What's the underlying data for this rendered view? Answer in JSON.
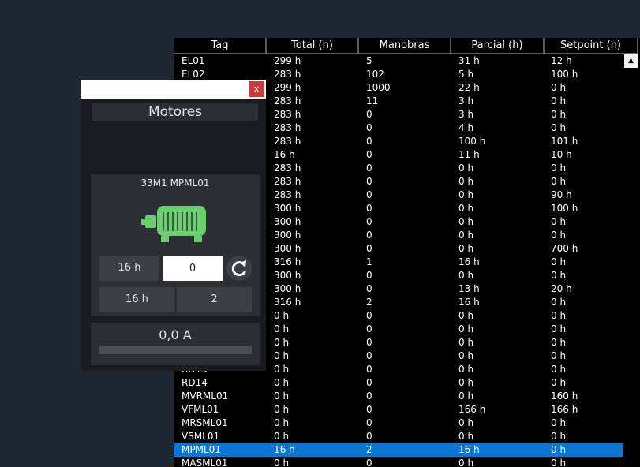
{
  "table": {
    "columns": [
      "Tag",
      "Total (h)",
      "Manobras",
      "Parcial (h)",
      "Setpoint (h)"
    ],
    "rows": [
      [
        "EL01",
        "299 h",
        "5",
        "31 h",
        "12 h"
      ],
      [
        "EL02",
        "283 h",
        "102",
        "5 h",
        "100 h"
      ],
      [
        "",
        "299 h",
        "1000",
        "22 h",
        "0 h"
      ],
      [
        "",
        "283 h",
        "11",
        "3 h",
        "0 h"
      ],
      [
        "",
        "283 h",
        "0",
        "3 h",
        "0 h"
      ],
      [
        "",
        "283 h",
        "0",
        "4 h",
        "0 h"
      ],
      [
        "",
        "283 h",
        "0",
        "100 h",
        "101 h"
      ],
      [
        "",
        "16 h",
        "0",
        "11 h",
        "10 h"
      ],
      [
        "",
        "283 h",
        "0",
        "0 h",
        "0 h"
      ],
      [
        "",
        "283 h",
        "0",
        "0 h",
        "0 h"
      ],
      [
        "",
        "283 h",
        "0",
        "0 h",
        "90 h"
      ],
      [
        "",
        "300 h",
        "0",
        "0 h",
        "100 h"
      ],
      [
        "",
        "300 h",
        "0",
        "0 h",
        "0 h"
      ],
      [
        "",
        "300 h",
        "0",
        "0 h",
        "0 h"
      ],
      [
        "",
        "300 h",
        "0",
        "0 h",
        "700 h"
      ],
      [
        "",
        "316 h",
        "1",
        "16 h",
        "0 h"
      ],
      [
        "",
        "300 h",
        "0",
        "0 h",
        "0 h"
      ],
      [
        "",
        "300 h",
        "0",
        "13 h",
        "20 h"
      ],
      [
        "",
        "316 h",
        "2",
        "16 h",
        "0 h"
      ],
      [
        "",
        "0 h",
        "0",
        "0 h",
        "0 h"
      ],
      [
        "",
        "0 h",
        "0",
        "0 h",
        "0 h"
      ],
      [
        "",
        "0 h",
        "0",
        "0 h",
        "0 h"
      ],
      [
        "",
        "0 h",
        "0",
        "0 h",
        "0 h"
      ],
      [
        "RD13",
        "0 h",
        "0",
        "0 h",
        "0 h"
      ],
      [
        "RD14",
        "0 h",
        "0",
        "0 h",
        "0 h"
      ],
      [
        "MVRML01",
        "0 h",
        "0",
        "0 h",
        "160 h"
      ],
      [
        "VFML01",
        "0 h",
        "0",
        "166 h",
        "166 h"
      ],
      [
        "MRSML01",
        "0 h",
        "0",
        "0 h",
        "0 h"
      ],
      [
        "VSML01",
        "0 h",
        "0",
        "0 h",
        "0 h"
      ],
      [
        "MPML01",
        "16 h",
        "2",
        "16 h",
        "0 h"
      ],
      [
        "MASML01",
        "0 h",
        "0",
        "0 h",
        "0 h"
      ]
    ],
    "selected_row": 29
  },
  "dialog": {
    "close_label": "x",
    "title": "Motores",
    "motor_name": "33M1 MPML01",
    "motor_icon": "motor-icon",
    "motor_color": "#6ccf6e",
    "total_hours": "16 h",
    "setpoint_input": "0",
    "reset_icon": "refresh-icon",
    "partial_hours": "16 h",
    "maneuvers": "2",
    "current": "0,0 A",
    "current_level": 0
  }
}
